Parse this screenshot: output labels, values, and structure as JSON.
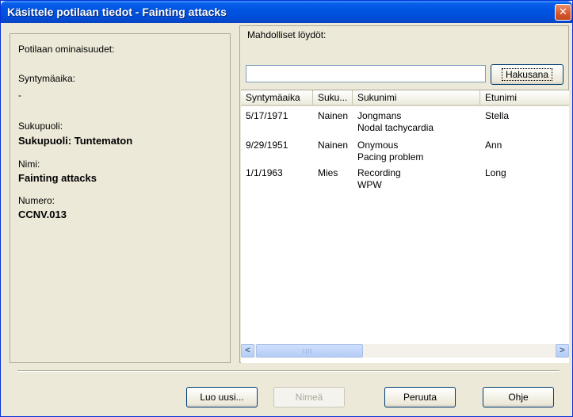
{
  "window": {
    "title": "Käsittele potilaan tiedot - Fainting attacks",
    "close_glyph": "✕"
  },
  "patient": {
    "properties_heading": "Potilaan ominaisuudet:",
    "birthdate_label": "Syntymäaika:",
    "birthdate_value": "-",
    "gender_label": "Sukupuoli:",
    "gender_value": "Sukupuoli: Tuntematon",
    "name_label": "Nimi:",
    "name_value": "Fainting attacks",
    "number_label": "Numero:",
    "number_value": "CCNV.013"
  },
  "search": {
    "found_label": "Mahdolliset löydöt:",
    "input_value": "",
    "button_label": "Hakusana"
  },
  "results": {
    "columns": [
      "Syntymäaika",
      "Suku...",
      "Sukunimi",
      "Etunimi"
    ],
    "rows": [
      {
        "birth": "5/17/1971",
        "gender": "Nainen",
        "lastname": "Jongmans",
        "note": "Nodal tachycardia",
        "firstname": "Stella"
      },
      {
        "birth": "9/29/1951",
        "gender": "Nainen",
        "lastname": "Onymous",
        "note": "Pacing problem",
        "firstname": "Ann"
      },
      {
        "birth": "1/1/1963",
        "gender": "Mies",
        "lastname": "Recording",
        "note": "WPW",
        "firstname": "Long"
      }
    ]
  },
  "scrollbar": {
    "left_glyph": "<",
    "right_glyph": ">",
    "grip": "IIII"
  },
  "buttons": {
    "new": "Luo uusi...",
    "rename": "Nimeä",
    "cancel": "Peruuta",
    "help": "Ohje"
  },
  "icons": {
    "close": "close-icon",
    "scroll_left": "chevron-left-icon",
    "scroll_right": "chevron-right-icon"
  },
  "colors": {
    "titlebar": "#0054e3",
    "window_bg": "#ece9d8",
    "close_button": "#d6552c"
  }
}
